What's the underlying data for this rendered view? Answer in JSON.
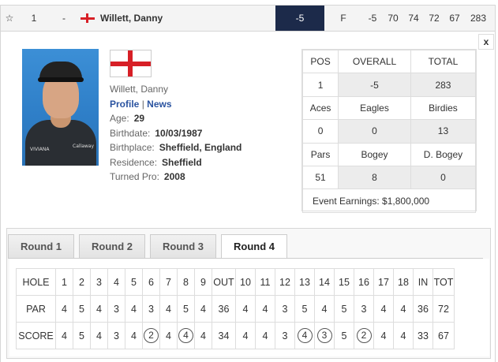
{
  "leaderboard_row": {
    "star_icon": "☆",
    "position": "1",
    "movement": "-",
    "flag": "england-flag",
    "player_name": "Willett, Danny",
    "score": "-5",
    "thru": "F",
    "today": "-5",
    "r1": "70",
    "r2": "74",
    "r3": "72",
    "r4": "67",
    "total": "283",
    "score_bg_color": "#1c2a4a"
  },
  "detail": {
    "close_label": "x",
    "name": "Willett, Danny",
    "profile_link": "Profile",
    "separator": "|",
    "news_link": "News",
    "age_label": "Age:",
    "age": "29",
    "birthdate_label": "Birthdate:",
    "birthdate": "10/03/1987",
    "birthplace_label": "Birthplace:",
    "birthplace": "Sheffield, England",
    "residence_label": "Residence:",
    "residence": "Sheffield",
    "turned_pro_label": "Turned Pro:",
    "turned_pro": "2008"
  },
  "stats": {
    "h1": [
      "POS",
      "OVERALL",
      "TOTAL"
    ],
    "v1": [
      "1",
      "-5",
      "283"
    ],
    "h2": [
      "Aces",
      "Eagles",
      "Birdies"
    ],
    "v2": [
      "0",
      "0",
      "13"
    ],
    "h3": [
      "Pars",
      "Bogey",
      "D. Bogey"
    ],
    "v3": [
      "51",
      "8",
      "0"
    ],
    "earnings": "Event Earnings: $1,800,000"
  },
  "rounds": {
    "tabs": [
      "Round 1",
      "Round 2",
      "Round 3",
      "Round 4"
    ],
    "active_tab": "Round 4"
  },
  "scorecard": {
    "hole_label": "HOLE",
    "par_label": "PAR",
    "score_label": "SCORE",
    "holes": [
      "1",
      "2",
      "3",
      "4",
      "5",
      "6",
      "7",
      "8",
      "9",
      "OUT",
      "10",
      "11",
      "12",
      "13",
      "14",
      "15",
      "16",
      "17",
      "18",
      "IN",
      "TOT"
    ],
    "par": [
      "4",
      "5",
      "4",
      "3",
      "4",
      "3",
      "4",
      "5",
      "4",
      "36",
      "4",
      "4",
      "3",
      "5",
      "4",
      "5",
      "3",
      "4",
      "4",
      "36",
      "72"
    ],
    "score": [
      "4",
      "5",
      "4",
      "3",
      "4",
      "2",
      "4",
      "4",
      "4",
      "34",
      "4",
      "4",
      "3",
      "4",
      "3",
      "5",
      "2",
      "4",
      "4",
      "33",
      "67"
    ],
    "circled_indices": [
      5,
      7,
      13,
      14,
      16
    ]
  }
}
